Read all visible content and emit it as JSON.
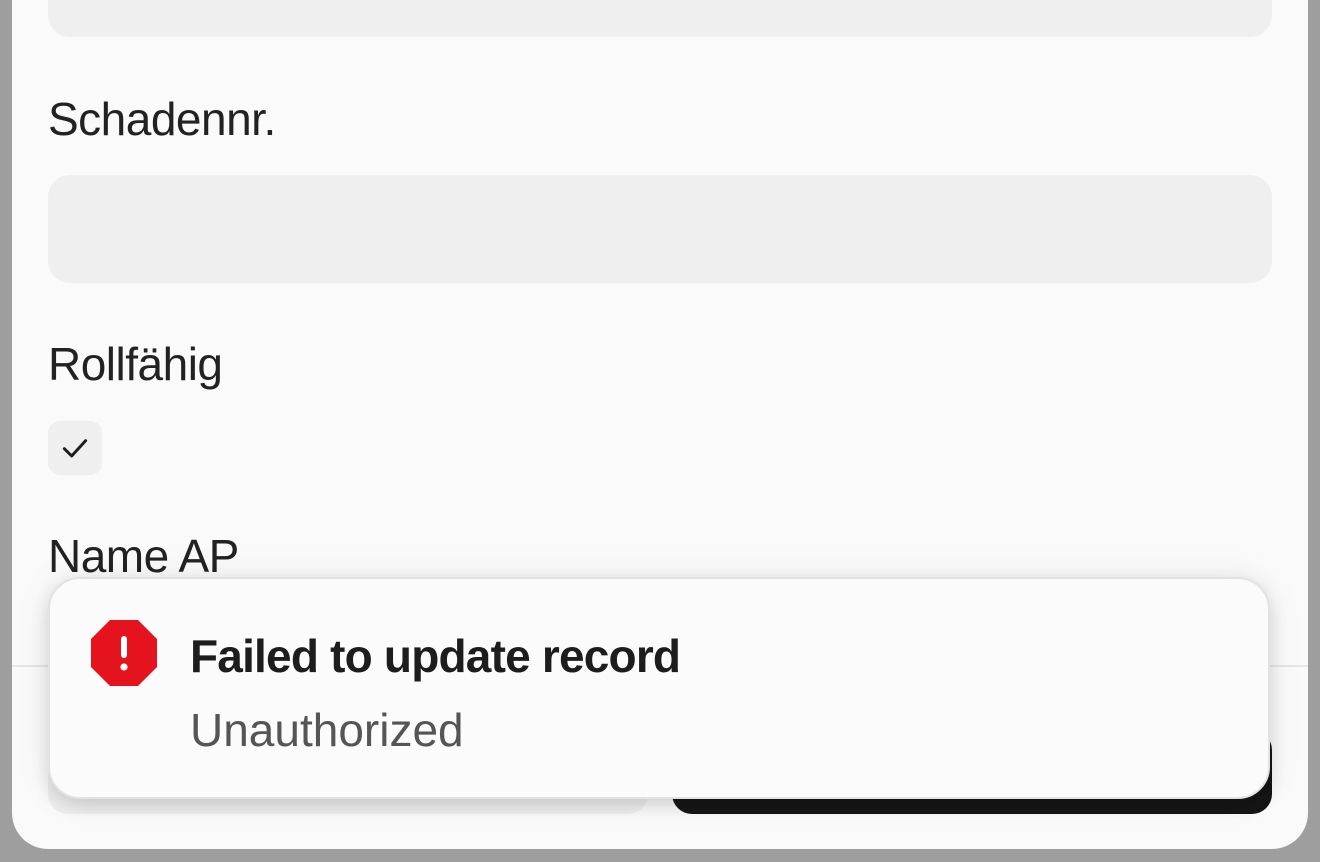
{
  "form": {
    "fields": [
      {
        "label": "Schadennr.",
        "value": ""
      },
      {
        "label": "Rollfähig",
        "checked": true
      },
      {
        "label": "Name AP"
      }
    ]
  },
  "toast": {
    "type": "error",
    "icon": "error-octagon-icon",
    "title": "Failed to update record",
    "description": "Unauthorized",
    "accent_color": "#e5131d"
  },
  "colors": {
    "backdrop": "#9e9e9e",
    "surface": "#fafafa",
    "input_bg": "#efefef",
    "primary_button": "#161616"
  }
}
